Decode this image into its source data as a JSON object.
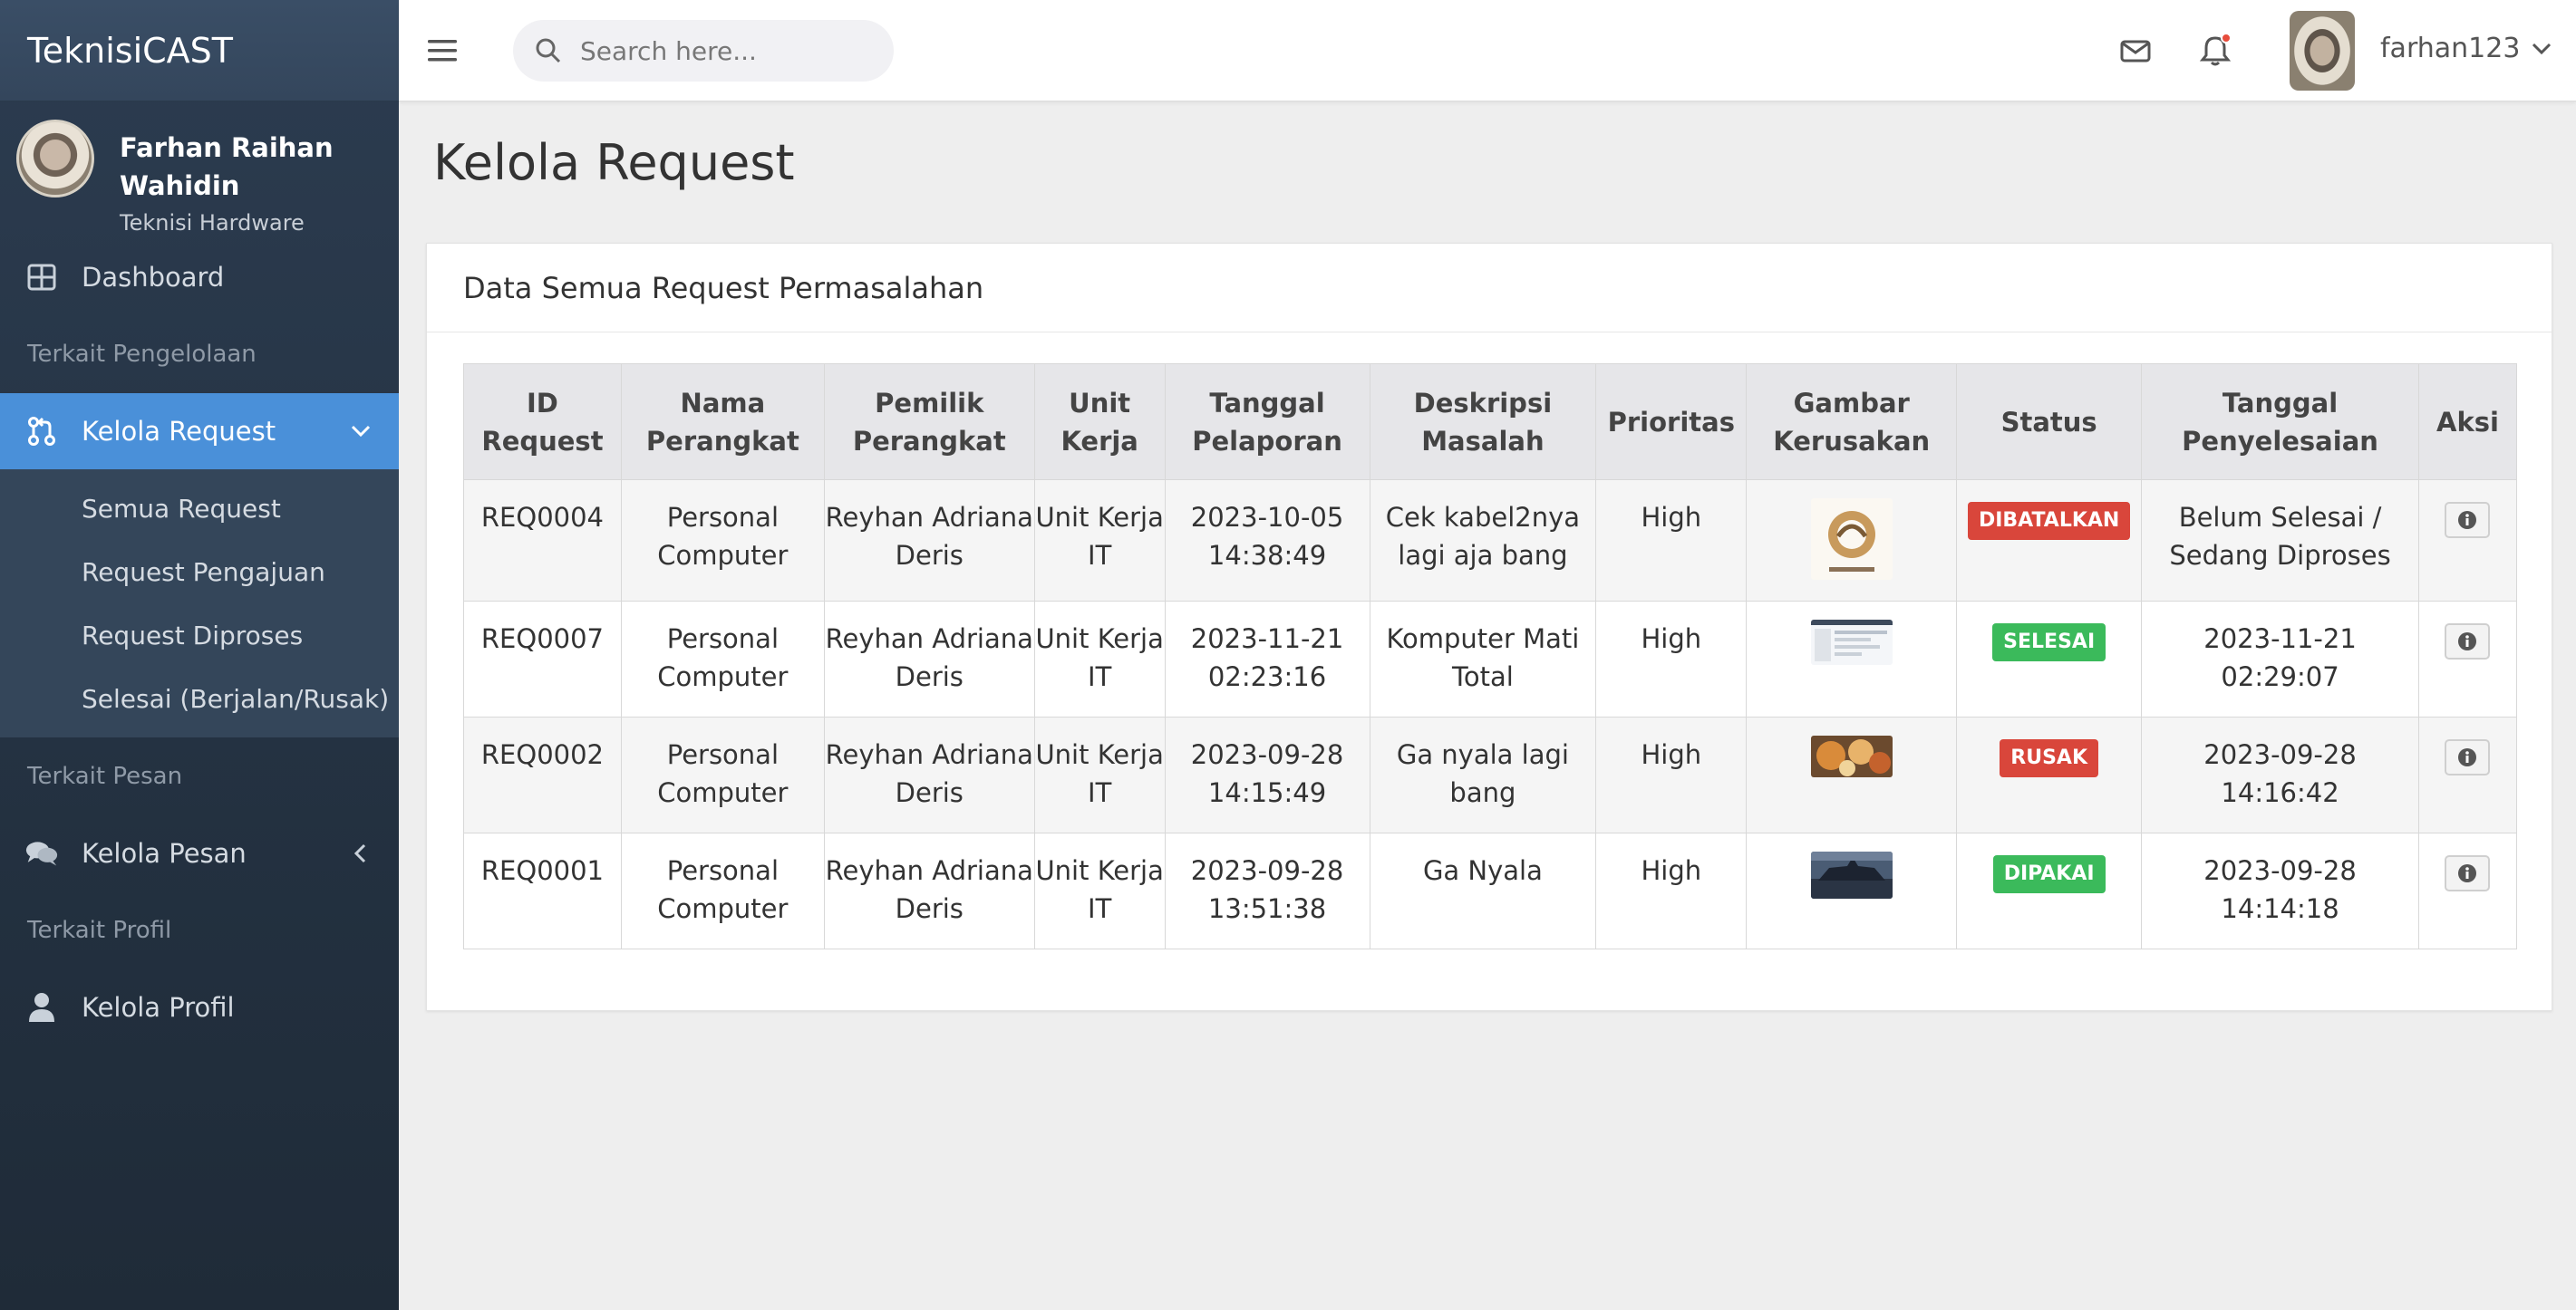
{
  "brand": "TeknisiCAST",
  "user": {
    "name": "Farhan Raihan Wahidin",
    "role": "Teknisi Hardware"
  },
  "sidebar": {
    "dashboard": "Dashboard",
    "header_pengelolaan": "Terkait Pengelolaan",
    "kelola_request": "Kelola Request",
    "submenu": [
      "Semua Request",
      "Request Pengajuan",
      "Request Diproses",
      "Selesai (Berjalan/Rusak)"
    ],
    "header_pesan": "Terkait Pesan",
    "kelola_pesan": "Kelola Pesan",
    "header_profil": "Terkait Profil",
    "kelola_profil": "Kelola Profil"
  },
  "topbar": {
    "search_placeholder": "Search here...",
    "username": "farhan123"
  },
  "page": {
    "title": "Kelola Request",
    "card_title": "Data Semua Request Permasalahan"
  },
  "table": {
    "headers": [
      "ID Request",
      "Nama Perangkat",
      "Pemilik Perangkat",
      "Unit Kerja",
      "Tanggal Pelaporan",
      "Deskripsi Masalah",
      "Prioritas",
      "Gambar Kerusakan",
      "Status",
      "Tanggal Penyelesaian",
      "Aksi"
    ],
    "rows": [
      {
        "id": "REQ0004",
        "device": "Personal Computer",
        "owner": "Reyhan Adriana Deris",
        "unit": "Unit Kerja IT",
        "reported": "2023-10-05 14:38:49",
        "desc": "Cek kabel2nya lagi aja bang",
        "priority": "High",
        "image": "logo-thumbnail",
        "status": "DIBATALKAN",
        "status_color": "#d9463b",
        "completed": "Belum Selesai / Sedang Diproses"
      },
      {
        "id": "REQ0007",
        "device": "Personal Computer",
        "owner": "Reyhan Adriana Deris",
        "unit": "Unit Kerja IT",
        "reported": "2023-11-21 02:23:16",
        "desc": "Komputer Mati Total",
        "priority": "High",
        "image": "screenshot-thumbnail",
        "status": "SELESAI",
        "status_color": "#3bba5b",
        "completed": "2023-11-21 02:29:07"
      },
      {
        "id": "REQ0002",
        "device": "Personal Computer",
        "owner": "Reyhan Adriana Deris",
        "unit": "Unit Kerja IT",
        "reported": "2023-09-28 14:15:49",
        "desc": "Ga nyala lagi bang",
        "priority": "High",
        "image": "food-thumbnail",
        "status": "RUSAK",
        "status_color": "#d9463b",
        "completed": "2023-09-28 14:16:42"
      },
      {
        "id": "REQ0001",
        "device": "Personal Computer",
        "owner": "Reyhan Adriana Deris",
        "unit": "Unit Kerja IT",
        "reported": "2023-09-28 13:51:38",
        "desc": "Ga Nyala",
        "priority": "High",
        "image": "ship-thumbnail",
        "status": "DIPAKAI",
        "status_color": "#3bba5b",
        "completed": "2023-09-28 14:14:18"
      }
    ]
  }
}
